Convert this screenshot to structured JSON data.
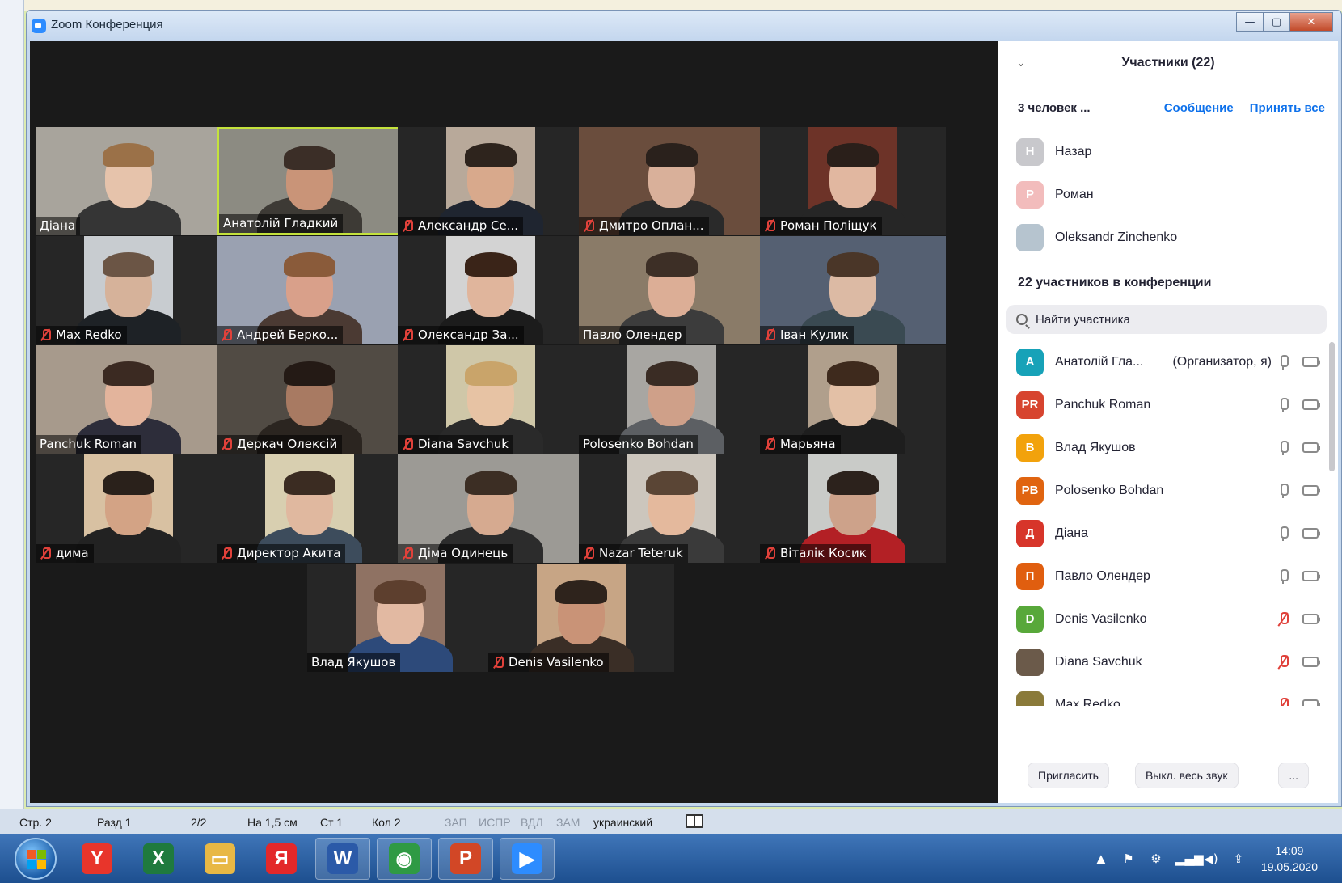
{
  "window": {
    "title": "Zoom Конференция",
    "minimize": "—",
    "maximize": "▢",
    "close": "✕"
  },
  "tiles": [
    {
      "name": "Діана",
      "muted": false,
      "active": false,
      "narrow": false,
      "bg": "#a8a49c",
      "skin": "#e6c3ab",
      "hair": "#9b7148",
      "shirt": "#353535"
    },
    {
      "name": "Анатолій Гладкий",
      "muted": false,
      "active": true,
      "narrow": false,
      "bg": "#8c8b82",
      "skin": "#c99478",
      "hair": "#3b2e27",
      "shirt": "#3d3a35"
    },
    {
      "name": "Александр Се...",
      "muted": true,
      "active": false,
      "narrow": true,
      "bg": "#b8a99a",
      "skin": "#d8a98c",
      "hair": "#2e241d",
      "shirt": "#1f2530"
    },
    {
      "name": "Дмитро Оплан...",
      "muted": true,
      "active": false,
      "narrow": false,
      "bg": "#6a4d3d",
      "skin": "#d9b09a",
      "hair": "#2a211c",
      "shirt": "#2a2a2a"
    },
    {
      "name": "Роман Поліщук",
      "muted": true,
      "active": false,
      "narrow": true,
      "bg": "#6d3328",
      "skin": "#e1b7a0",
      "hair": "#2a1f1a",
      "shirt": "#262626"
    },
    {
      "name": "Max Redko",
      "muted": true,
      "active": false,
      "narrow": true,
      "bg": "#c8ccd0",
      "skin": "#d6b29a",
      "hair": "#6b5545",
      "shirt": "#1e2226"
    },
    {
      "name": "Андрей Берко...",
      "muted": true,
      "active": false,
      "narrow": false,
      "bg": "#9aa1b1",
      "skin": "#d9a08a",
      "hair": "#8a5b3a",
      "shirt": "#4b3a33"
    },
    {
      "name": "Олександр За...",
      "muted": true,
      "active": false,
      "narrow": true,
      "bg": "#d3d3d3",
      "skin": "#e0b59c",
      "hair": "#3a2418",
      "shirt": "#1c1c1c"
    },
    {
      "name": "Павло Олендер",
      "muted": false,
      "active": false,
      "narrow": false,
      "bg": "#8a7b68",
      "skin": "#dcae96",
      "hair": "#3d2f26",
      "shirt": "#3c3c3c"
    },
    {
      "name": "Іван Кулик",
      "muted": true,
      "active": false,
      "narrow": false,
      "bg": "#556072",
      "skin": "#dcbaa4",
      "hair": "#4a3628",
      "shirt": "#3a4a52"
    },
    {
      "name": "Panchuk Roman",
      "muted": false,
      "active": false,
      "narrow": false,
      "bg": "#a79a8c",
      "skin": "#e3b49c",
      "hair": "#3b2a22",
      "shirt": "#2d2d3a"
    },
    {
      "name": "Деркач Олексій",
      "muted": true,
      "active": false,
      "narrow": false,
      "bg": "#514b44",
      "skin": "#a87a62",
      "hair": "#241a15",
      "shirt": "#2b2520"
    },
    {
      "name": "Diana Savchuk",
      "muted": true,
      "active": false,
      "narrow": true,
      "bg": "#cfc7a8",
      "skin": "#e7c3a4",
      "hair": "#c9a46a",
      "shirt": "#2a2a2a"
    },
    {
      "name": "Polosenko Bohdan",
      "muted": false,
      "active": false,
      "narrow": true,
      "bg": "#a8a6a2",
      "skin": "#cfa089",
      "hair": "#3a2c24",
      "shirt": "#5c5f63"
    },
    {
      "name": "Марьяна",
      "muted": true,
      "active": false,
      "narrow": true,
      "bg": "#b09f8c",
      "skin": "#e3c0a6",
      "hair": "#3e2a1d",
      "shirt": "#1e1e1e"
    },
    {
      "name": "дима",
      "muted": true,
      "active": false,
      "narrow": true,
      "bg": "#d8c1a2",
      "skin": "#d3a385",
      "hair": "#2a211b",
      "shirt": "#222222"
    },
    {
      "name": "Директор Акита",
      "muted": true,
      "active": false,
      "narrow": true,
      "bg": "#d8cfb0",
      "skin": "#e0b89f",
      "hair": "#3b2c22",
      "shirt": "#3d4c5c"
    },
    {
      "name": "Діма Одинець",
      "muted": true,
      "active": false,
      "narrow": false,
      "bg": "#9c9a95",
      "skin": "#d6aa90",
      "hair": "#3c2e24",
      "shirt": "#2c2c2c"
    },
    {
      "name": "Nazar Teteruk",
      "muted": true,
      "active": false,
      "narrow": true,
      "bg": "#ccc6bd",
      "skin": "#e4b99d",
      "hair": "#5a4535",
      "shirt": "#3a3a3a"
    },
    {
      "name": "Віталік Косик",
      "muted": true,
      "active": false,
      "narrow": true,
      "bg": "#c9cbc8",
      "skin": "#cda28a",
      "hair": "#2c221c",
      "shirt": "#b32025"
    },
    {
      "name": "Влад Якушов",
      "muted": false,
      "active": false,
      "narrow": true,
      "bg": "#8f7263",
      "skin": "#e2b9a2",
      "hair": "#5d3f2e",
      "shirt": "#2d4a7a"
    },
    {
      "name": "Denis Vasilenko",
      "muted": true,
      "active": false,
      "narrow": true,
      "bg": "#c7a585",
      "skin": "#c99377",
      "hair": "#2e231c",
      "shirt": "#3a2e26"
    }
  ],
  "panel": {
    "title": "Участники (22)",
    "collapse_icon": "⌄",
    "waiting_label": "3 человек ...",
    "message_link": "Сообщение",
    "admit_all_link": "Принять все",
    "waiting": [
      {
        "initial": "Н",
        "name": "Назар",
        "color": "#c8c8cc"
      },
      {
        "initial": "Р",
        "name": "Роман",
        "color": "#f2bcbc"
      },
      {
        "initial": "",
        "name": "Oleksandr Zinchenko",
        "color": "#b6c4cf"
      }
    ],
    "in_meeting_title": "22 участников в конференции",
    "search_placeholder": "Найти участника",
    "participants": [
      {
        "initial": "А",
        "name": "Анатолій Гла...",
        "role": "(Организатор, я)",
        "color": "#17a2b8",
        "muted": false
      },
      {
        "initial": "PR",
        "name": "Panchuk Roman",
        "role": "",
        "color": "#d7442f",
        "muted": false
      },
      {
        "initial": "В",
        "name": "Влад Якушов",
        "role": "",
        "color": "#f2a20c",
        "muted": false
      },
      {
        "initial": "PB",
        "name": "Polosenko Bohdan",
        "role": "",
        "color": "#e06410",
        "muted": false
      },
      {
        "initial": "Д",
        "name": "Діана",
        "role": "",
        "color": "#d7352a",
        "muted": false
      },
      {
        "initial": "П",
        "name": "Павло Олендер",
        "role": "",
        "color": "#e05e0f",
        "muted": false
      },
      {
        "initial": "D",
        "name": "Denis Vasilenko",
        "role": "",
        "color": "#58a83a",
        "muted": true
      },
      {
        "initial": "",
        "name": "Diana Savchuk",
        "role": "",
        "color": "#6b5a4a",
        "muted": true
      },
      {
        "initial": "",
        "name": "Max Redko",
        "role": "",
        "color": "#8a7a3a",
        "muted": true
      }
    ],
    "invite_button": "Пригласить",
    "mute_all_button": "Выкл. весь звук",
    "more_button": "..."
  },
  "statusbar": {
    "page": "Стр. 2",
    "section": "Разд 1",
    "pages": "2/2",
    "at": "На 1,5 см",
    "line": "Ст 1",
    "col": "Кол 2",
    "rec": "ЗАП",
    "trk": "ИСПР",
    "ext": "ВДЛ",
    "ovr": "ЗАМ",
    "language": "украинский"
  },
  "taskbar": {
    "apps": [
      {
        "name": "yandex-browser",
        "glyph": "Y",
        "color": "#e8352b"
      },
      {
        "name": "excel",
        "glyph": "X",
        "color": "#1f7a3e"
      },
      {
        "name": "file-explorer",
        "glyph": "▭",
        "color": "#e8b845"
      },
      {
        "name": "yandex",
        "glyph": "Я",
        "color": "#e3282a"
      },
      {
        "name": "word",
        "glyph": "W",
        "color": "#2b5aa8"
      },
      {
        "name": "chrome",
        "glyph": "◉",
        "color": "#2f9a44"
      },
      {
        "name": "powerpoint",
        "glyph": "P",
        "color": "#d24726"
      },
      {
        "name": "zoom",
        "glyph": "▶",
        "color": "#2d8cff"
      }
    ],
    "tray_icons": [
      "▲",
      "⚑",
      "⚙",
      "▂▄▆",
      "◀)",
      "⇪"
    ],
    "time": "14:09",
    "date": "19.05.2020"
  }
}
